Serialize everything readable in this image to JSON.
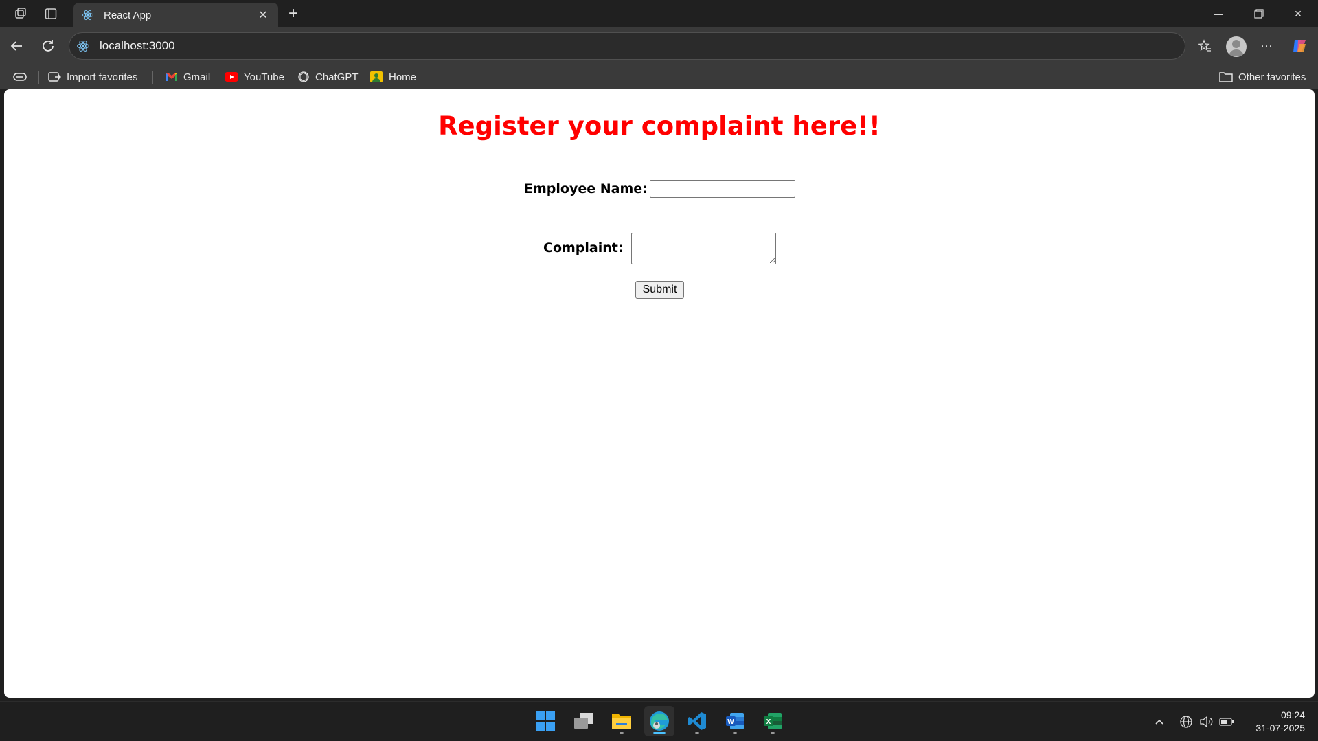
{
  "browser": {
    "tab_title": "React App",
    "url": "localhost:3000",
    "favorites": [
      {
        "label": "Import favorites"
      },
      {
        "label": "Gmail"
      },
      {
        "label": "YouTube"
      },
      {
        "label": "ChatGPT"
      },
      {
        "label": "Home"
      }
    ],
    "other_favorites": "Other favorites"
  },
  "page": {
    "title": "Register your complaint here!!",
    "form": {
      "name_label": "Employee Name:",
      "name_value": "",
      "complaint_label": "Complaint:",
      "complaint_value": "",
      "submit_label": "Submit"
    }
  },
  "taskbar": {
    "apps": [
      "start",
      "task-view",
      "file-explorer",
      "edge",
      "vscode",
      "word",
      "excel"
    ],
    "active_app": "edge",
    "time": "09:24",
    "date": "31-07-2025"
  },
  "colors": {
    "title": "#ff0000",
    "chrome_dark": "#202020",
    "chrome_mid": "#3a3a3a",
    "accent": "#4cc2ff"
  }
}
